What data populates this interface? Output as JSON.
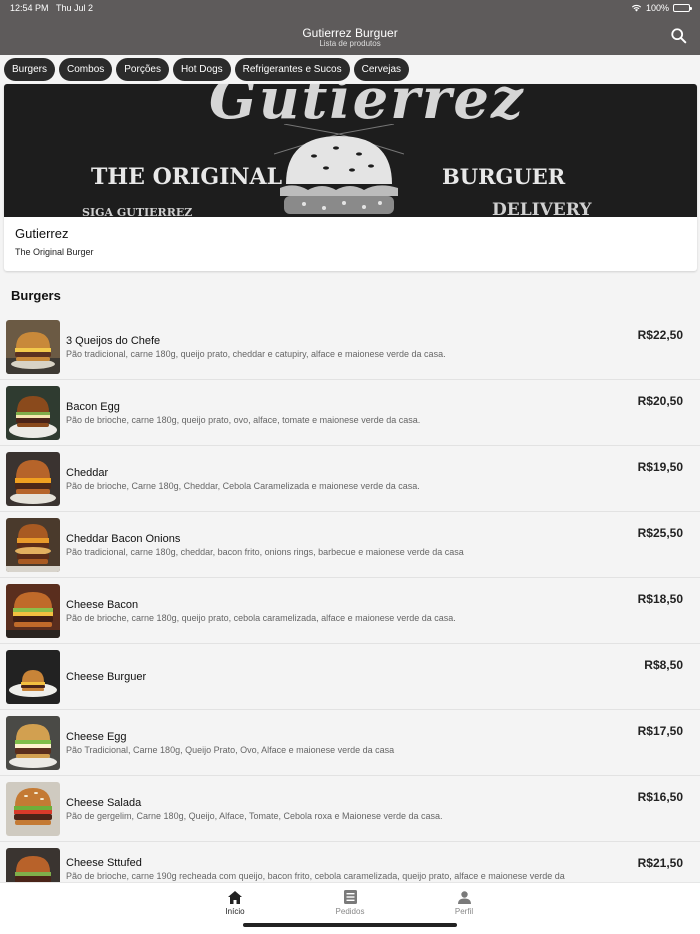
{
  "status_bar": {
    "time": "12:54 PM",
    "date": "Thu Jul 2",
    "battery": "100%"
  },
  "header": {
    "title": "Gutierrez Burguer",
    "subtitle": "Lista de produtos",
    "search_icon": "search-icon"
  },
  "categories": [
    "Burgers",
    "Combos",
    "Porções",
    "Hot Dogs",
    "Refrigerantes e Sucos",
    "Cervejas"
  ],
  "restaurant": {
    "banner_text": {
      "brand": "Gutierrez",
      "left": "THE ORIGINAL",
      "right": "BURGUER",
      "bottom_left": "SIGA GUTIERREZ",
      "bottom_right": "DELIVERY"
    },
    "name": "Gutierrez",
    "tagline": "The Original Burger"
  },
  "section": {
    "title": "Burgers"
  },
  "products": [
    {
      "name": "3 Queijos do Chefe",
      "description": "Pão tradicional, carne 180g, queijo prato, cheddar e catupiry, alface e maionese verde da casa.",
      "price": "R$22,50"
    },
    {
      "name": "Bacon Egg",
      "description": "Pão de brioche, carne 180g, queijo prato, ovo, alface, tomate e maionese verde da casa.",
      "price": "R$20,50"
    },
    {
      "name": "Cheddar",
      "description": "Pão de brioche, Carne 180g, Cheddar, Cebola Caramelizada e maionese verde da casa.",
      "price": "R$19,50"
    },
    {
      "name": "Cheddar Bacon Onions",
      "description": "Pão tradicional, carne 180g, cheddar, bacon frito, onions rings, barbecue e maionese verde da casa",
      "price": "R$25,50"
    },
    {
      "name": "Cheese Bacon",
      "description": "Pão de brioche, carne 180g, queijo prato, cebola caramelizada, alface e maionese verde da casa.",
      "price": "R$18,50"
    },
    {
      "name": "Cheese Burguer",
      "description": "",
      "price": "R$8,50"
    },
    {
      "name": "Cheese Egg",
      "description": "Pão Tradicional, Carne 180g, Queijo Prato, Ovo, Alface e maionese verde da casa",
      "price": "R$17,50"
    },
    {
      "name": "Cheese Salada",
      "description": "Pão de gergelim, Carne 180g, Queijo, Alface, Tomate, Cebola roxa e Maionese verde da casa.",
      "price": "R$16,50"
    },
    {
      "name": "Cheese Sttufed",
      "description": "Pão de brioche, carne 190g recheada com queijo, bacon frito, cebola caramelizada, queijo prato, alface e maionese verde da",
      "price": "R$21,50"
    }
  ],
  "bottom_nav": [
    {
      "label": "Início",
      "icon": "home-icon",
      "active": true
    },
    {
      "label": "Pedidos",
      "icon": "orders-icon",
      "active": false
    },
    {
      "label": "Perfil",
      "icon": "profile-icon",
      "active": false
    }
  ],
  "colors": {
    "header_bg": "#5e5b5b",
    "chip_bg": "#2b2b2b",
    "page_bg": "#f4f4f4"
  }
}
